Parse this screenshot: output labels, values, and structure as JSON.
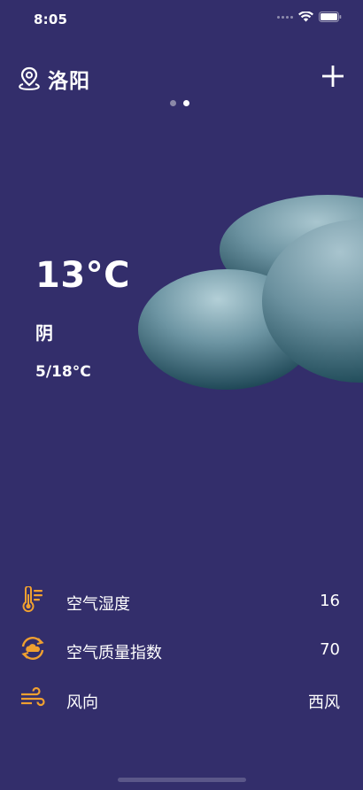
{
  "status_bar": {
    "time": "8:05"
  },
  "header": {
    "city": "洛阳",
    "add_icon": "plus-icon",
    "location_icon": "location-pin-icon"
  },
  "pager": {
    "total": 2,
    "active_index": 1
  },
  "weather": {
    "temperature": "13°C",
    "condition": "阴",
    "range": "5/18°C",
    "illustration": "cloud-icon"
  },
  "details": [
    {
      "icon": "thermometer-icon",
      "label": "空气湿度",
      "value": "16"
    },
    {
      "icon": "air-quality-cycle-icon",
      "label": "空气质量指数",
      "value": "70"
    },
    {
      "icon": "wind-icon",
      "label": "风向",
      "value": "西风"
    }
  ],
  "colors": {
    "background": "#332e6b",
    "accent": "#f0a030",
    "cloud": "#5f8a98"
  }
}
